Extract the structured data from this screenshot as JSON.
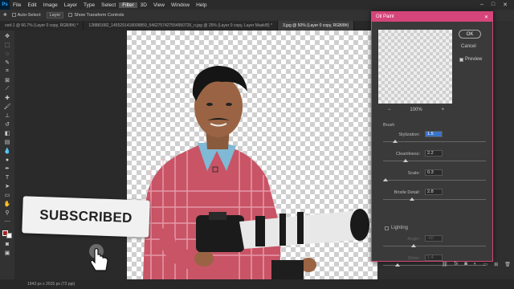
{
  "app": {
    "logo": "Ps"
  },
  "menu": [
    "File",
    "Edit",
    "Image",
    "Layer",
    "Type",
    "Select",
    "Filter",
    "3D",
    "View",
    "Window",
    "Help"
  ],
  "menu_active": "Filter",
  "window_controls": [
    "–",
    "□",
    "✕"
  ],
  "options": {
    "auto_select_label": "Auto-Select:",
    "layer_value": "Layer",
    "transform_label": "Show Transform Controls"
  },
  "tabs": [
    {
      "label": "ced-1 @ 66.7% (Layer 0 copy, RGB/8#) *",
      "active": false
    },
    {
      "label": "128881682_1455291418009859_5462757427554950726_n.jpg @ 25% (Layer 0 copy, Layer Mask/8) *",
      "active": false
    },
    {
      "label": "3.jpg @ 50% (Layer 0 copy, RGB/8#)",
      "active": true
    }
  ],
  "status": {
    "doc_size": "1943 px x 2015 px (72 ppi)"
  },
  "overlay": {
    "subscribe": "SUBSCRIBED"
  },
  "dialog": {
    "title": "Oil Paint",
    "close": "✕",
    "ok": "OK",
    "cancel": "Cancel",
    "preview": "Preview",
    "zoom": "100%",
    "zoom_out_icon": "−",
    "zoom_in_icon": "+",
    "brush_heading": "Brush",
    "params": [
      {
        "label": "Stylization:",
        "value": "1.5",
        "level": 0.12,
        "selected": true,
        "enabled": true
      },
      {
        "label": "Cleanliness:",
        "value": "2.2",
        "level": 0.22,
        "selected": false,
        "enabled": true
      },
      {
        "label": "Scale:",
        "value": "0.3",
        "level": 0.02,
        "selected": false,
        "enabled": true
      },
      {
        "label": "Bristle Detail:",
        "value": "2.8",
        "level": 0.28,
        "selected": false,
        "enabled": true
      }
    ],
    "lighting_label": "Lighting",
    "lighting_params": [
      {
        "label": "Angle:",
        "value": "-60",
        "level": 0.3,
        "enabled": false
      },
      {
        "label": "Shine:",
        "value": "1.4",
        "level": 0.14,
        "enabled": false
      }
    ]
  },
  "colors": {
    "accent": "#d6457a",
    "foreground": "#b01c1c"
  }
}
